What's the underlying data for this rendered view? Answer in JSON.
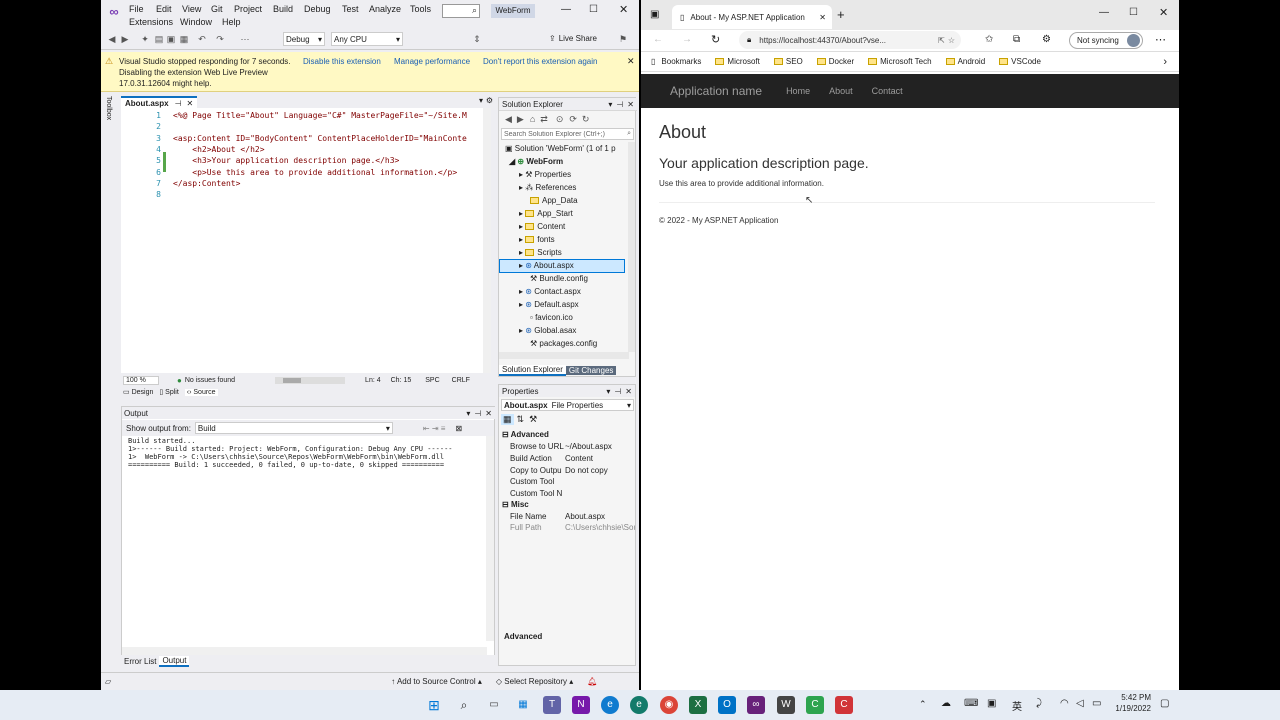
{
  "vs": {
    "menu": [
      "File",
      "Edit",
      "View",
      "Git",
      "Project",
      "Build",
      "Debug",
      "Test",
      "Analyze",
      "Tools"
    ],
    "menu2": [
      "Extensions",
      "Window",
      "Help"
    ],
    "search_placeholder": "",
    "title": "WebForm",
    "toolbar": {
      "config": "Debug",
      "platform": "Any CPU",
      "live_share": "Live Share"
    },
    "info": {
      "line1": "Visual Studio stopped responding for 7 seconds.",
      "line2": "Disabling the extension Web Live Preview",
      "line3": "17.0.31.12604 might help.",
      "disable": "Disable this extension",
      "manage": "Manage performance",
      "dont": "Don't report this extension again"
    },
    "editor": {
      "tab": "About.aspx",
      "lines": [
        {
          "n": "1",
          "text": "<%@ Page Title=\"About\" Language=\"C#\" MasterPageFile=\"~/Site.M"
        },
        {
          "n": "2",
          "text": ""
        },
        {
          "n": "3",
          "text": "<asp:Content ID=\"BodyContent\" ContentPlaceHolderID=\"MainConte"
        },
        {
          "n": "4",
          "text": "    <h2>About </h2>"
        },
        {
          "n": "5",
          "text": "    <h3>Your application description page.</h3>"
        },
        {
          "n": "6",
          "text": "    <p>Use this area to provide additional information.</p>"
        },
        {
          "n": "7",
          "text": "</asp:Content>"
        },
        {
          "n": "8",
          "text": ""
        }
      ],
      "zoom": "100 %",
      "issues": "No issues found",
      "ln": "Ln: 4",
      "ch": "Ch: 15",
      "spc": "SPC",
      "crlf": "CRLF",
      "views": [
        "Design",
        "Split",
        "Source"
      ]
    },
    "output": {
      "title": "Output",
      "show_from_label": "Show output from:",
      "show_from_value": "Build",
      "lines": [
        "Build started...",
        "1>------ Build started: Project: WebForm, Configuration: Debug Any CPU ------",
        "1>  WebForm -> C:\\Users\\chhsie\\Source\\Repos\\WebForm\\WebForm\\bin\\WebForm.dll",
        "========== Build: 1 succeeded, 0 failed, 0 up-to-date, 0 skipped =========="
      ]
    },
    "bottom_tabs": [
      "Error List",
      "Output"
    ],
    "solution_explorer": {
      "title": "Solution Explorer",
      "search_placeholder": "Search Solution Explorer (Ctrl+;)",
      "solution": "Solution 'WebForm' (1 of 1 p",
      "project": "WebForm",
      "items": [
        "Properties",
        "References",
        "App_Data",
        "App_Start",
        "Content",
        "fonts",
        "Scripts",
        "About.aspx",
        "Bundle.config",
        "Contact.aspx",
        "Default.aspx",
        "favicon.ico",
        "Global.asax",
        "packages.config"
      ],
      "tabs": [
        "Solution Explorer",
        "Git Changes"
      ]
    },
    "properties": {
      "title": "Properties",
      "object": "About.aspx",
      "object_type": "File Properties",
      "cat1": "Advanced",
      "rows1": [
        [
          "Browse to URL",
          "~/About.aspx"
        ],
        [
          "Build Action",
          "Content"
        ],
        [
          "Copy to Outpu",
          "Do not copy"
        ],
        [
          "Custom Tool",
          ""
        ],
        [
          "Custom Tool N",
          ""
        ]
      ],
      "cat2": "Misc",
      "rows2": [
        [
          "File Name",
          "About.aspx"
        ],
        [
          "Full Path",
          "C:\\Users\\chhsie\\Sou"
        ]
      ],
      "desc": "Advanced"
    },
    "status": {
      "add_source": "Add to Source Control",
      "select_repo": "Select Repository",
      "notif_count": "1"
    }
  },
  "browser": {
    "tab_title": "About - My ASP.NET Application",
    "url": "https://localhost:44370/About?vse...",
    "sync": "Not syncing",
    "bookmarks": [
      "Bookmarks",
      "Microsoft",
      "SEO",
      "Docker",
      "Microsoft Tech",
      "Android",
      "VSCode"
    ],
    "nav": {
      "brand": "Application name",
      "links": [
        "Home",
        "About",
        "Contact"
      ]
    },
    "page": {
      "h2": "About",
      "h3": "Your application description page.",
      "p": "Use this area to provide additional information.",
      "footer": "© 2022 - My ASP.NET Application"
    }
  },
  "taskbar": {
    "time": "5:42 PM",
    "date": "1/19/2022",
    "ime": "英"
  }
}
